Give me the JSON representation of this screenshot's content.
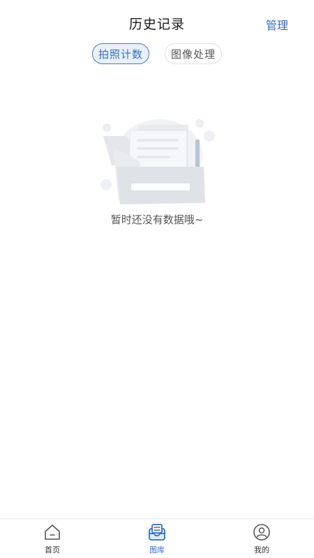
{
  "header": {
    "title": "历史记录",
    "manage_label": "管理"
  },
  "tabs": [
    {
      "label": "拍照计数",
      "active": true
    },
    {
      "label": "图像处理",
      "active": false
    }
  ],
  "empty_state": {
    "message": "暂时还没有数据哦~",
    "icon": "empty-folder-illustration"
  },
  "bottom_nav": {
    "items": [
      {
        "label": "首页",
        "icon": "home-icon",
        "active": false
      },
      {
        "label": "图库",
        "icon": "gallery-icon",
        "active": true
      },
      {
        "label": "我的",
        "icon": "user-icon",
        "active": false
      }
    ]
  },
  "colors": {
    "accent": "#2f6fc8",
    "tab_active_bg": "#e9f0fb",
    "text_primary": "#1a1a1a",
    "text_secondary": "#555555"
  }
}
